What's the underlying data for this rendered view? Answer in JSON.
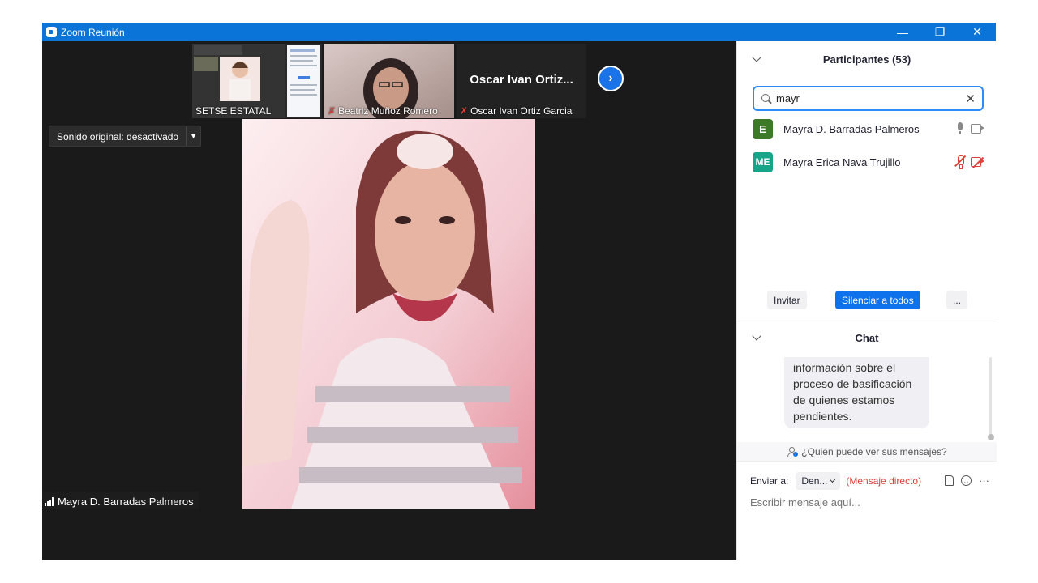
{
  "window": {
    "title": "Zoom Reunión",
    "controls": [
      "—",
      "❐",
      "✕"
    ],
    "accent": "#0b74d8"
  },
  "meeting": {
    "thumbnails": [
      {
        "label": "SETSE ESTATAL",
        "muted": false
      },
      {
        "label": "Beatriz Muñoz Romero",
        "muted": true
      },
      {
        "label": "Oscar Ivan Ortiz Garcia",
        "display_name": "Oscar Ivan Ortiz...",
        "muted": true
      }
    ],
    "sound_dropdown": "Sonido original: desactivado",
    "active_speaker": "Mayra D. Barradas Palmeros"
  },
  "participants": {
    "title": "Participantes (53)",
    "search_value": "mayr",
    "list": [
      {
        "initials": "E",
        "name": "Mayra D. Barradas Palmeros",
        "color": "#3c7a28",
        "mic_muted": false,
        "video_off": false
      },
      {
        "initials": "ME",
        "name": "Mayra Erica Nava Trujillo",
        "color": "#17a58a",
        "mic_muted": true,
        "video_off": true
      }
    ],
    "buttons": {
      "invite": "Invitar",
      "mute_all": "Silenciar a todos",
      "more": "..."
    }
  },
  "chat": {
    "title": "Chat",
    "message_lines": [
      "información sobre el",
      "proceso de basificación",
      "de quienes estamos",
      "pendientes."
    ],
    "who_can_see": "¿Quién puede ver sus mensajes?",
    "send_to_label": "Enviar a:",
    "send_to_value": "Den...",
    "direct_message": "(Mensaje directo)",
    "more_tools": "···",
    "input_placeholder": "Escribir mensaje aquí..."
  }
}
